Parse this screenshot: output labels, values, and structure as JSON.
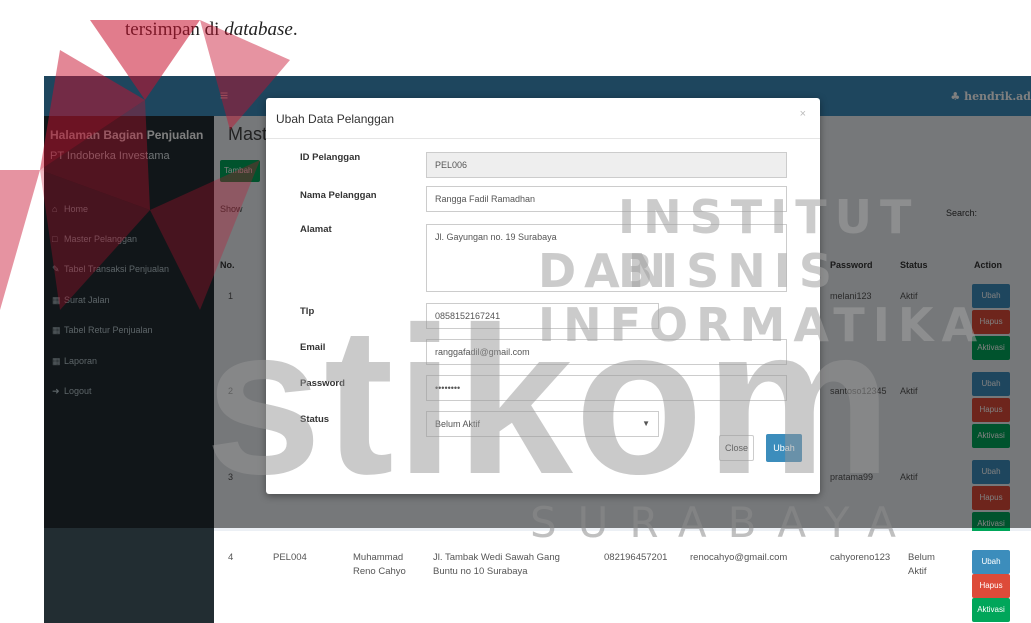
{
  "doc": {
    "text_before": "tersimpan di ",
    "text_italic": "database",
    "text_after": "."
  },
  "topbar": {
    "user": "♣ hendrik.ad"
  },
  "sidebar": {
    "brand_line1": "Halaman Bagian Penjualan",
    "brand_line2": "PT Indoberka Investama",
    "items": [
      {
        "label": "Home",
        "icon": "home-icon"
      },
      {
        "label": "Master Pelanggan",
        "icon": "monitor-icon"
      },
      {
        "label": "Tabel Transaksi Penjualan",
        "icon": "edit-icon"
      },
      {
        "label": "Surat Jalan",
        "icon": "table-icon"
      },
      {
        "label": "Tabel Retur Penjualan",
        "icon": "table-icon"
      },
      {
        "label": "Laporan",
        "icon": "table-icon"
      },
      {
        "label": "Logout",
        "icon": "logout-icon"
      }
    ]
  },
  "content": {
    "title": "Maste",
    "add_button": "Tambah",
    "show": "Show",
    "search_label": "Search:",
    "headers": {
      "no": "No.",
      "password": "Password",
      "status": "Status",
      "action": "Action"
    },
    "rows": [
      {
        "no": "1",
        "password": "melani123",
        "status": "Aktif"
      },
      {
        "no": "2",
        "password": "santoso12345",
        "status": "Aktif"
      },
      {
        "no": "3",
        "password": "pratama99",
        "status": "Aktif"
      },
      {
        "no": "4",
        "id": "PEL004",
        "nama": "Muhammad Reno Cahyo",
        "alamat": "Jl. Tambak Wedi Sawah Gang Buntu no 10 Surabaya",
        "tlp": "082196457201",
        "email": "renocahyo@gmail.com",
        "password": "cahyoreno123",
        "status": "Belum Aktif"
      }
    ],
    "buttons": {
      "ubah": "Ubah",
      "hapus": "Hapus",
      "aktivasi": "Aktivasi"
    }
  },
  "modal": {
    "title": "Ubah Data Pelanggan",
    "close_x": "×",
    "fields": {
      "id_label": "ID Pelanggan",
      "id_value": "PEL006",
      "nama_label": "Nama Pelanggan",
      "nama_value": "Rangga Fadil Ramadhan",
      "alamat_label": "Alamat",
      "alamat_value": "Jl. Gayungan no. 19 Surabaya",
      "tlp_label": "Tlp",
      "tlp_value": "0858152167241",
      "email_label": "Email",
      "email_value": "ranggafadil@gmail.com",
      "password_label": "Password",
      "password_value": "••••••••",
      "status_label": "Status",
      "status_value": "Belum Aktif"
    },
    "close_button": "Close",
    "save_button": "Ubah"
  },
  "watermark": {
    "line1": "INSTITUT BISNIS",
    "line2": "DAN INFORMATIKA",
    "brand": "stikom",
    "city": "SURABAYA",
    "colors": {
      "red": "#c8102e",
      "gray": "#9a9a9a"
    }
  }
}
